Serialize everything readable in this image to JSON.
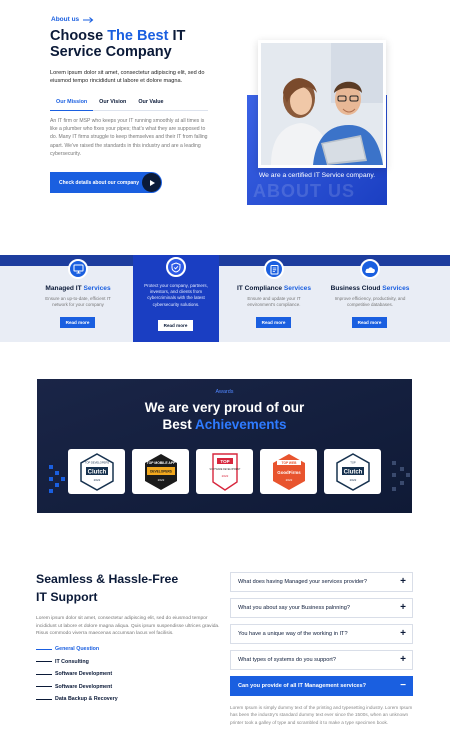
{
  "about": {
    "eyebrow": "About us",
    "title_part1": "Choose ",
    "title_highlight": "The Best",
    "title_part2": " IT Service Company",
    "lead": "Lorem ipsum dolor sit amet, consectetur adipiscing elit, sed do eiusmod tempo rincididunt ut labore et dolore magna.",
    "tabs": [
      {
        "label": "Our Mission",
        "active": true
      },
      {
        "label": "Our Vision",
        "active": false
      },
      {
        "label": "Our Value",
        "active": false
      }
    ],
    "tab_body": "An IT firm or MSP who keeps your IT running smoothly at all times is like a plumber who fixes your pipes; that's what they are supposed to do. Many IT firms struggle to keep themselves and their IT from falling apart. We've raised the standards in this industry and are a leading cybersecurity.",
    "cta_label": "Check details about our company",
    "photo_caption": "We are a certified IT Service company.",
    "photo_bg_text": "ABOUT US",
    "colors": {
      "accent": "#1a5fe0",
      "navy": "#0b1a38"
    }
  },
  "services": [
    {
      "title": "Managed IT ",
      "title_highlight": "Services",
      "desc": "Ensure an up-to-date, efficient IT network for your company",
      "button": "Read more",
      "icon": "monitor-icon",
      "featured": false
    },
    {
      "title": "",
      "title_highlight": "",
      "desc": "Protect your company, partners, investors, and clients from cybercriminals with the latest cybersecurity solutions.",
      "button": "Read more",
      "icon": "shield-icon",
      "featured": true
    },
    {
      "title": "IT Compliance ",
      "title_highlight": "Services",
      "desc": "Ensure and update your IT environment's compliance.",
      "button": "Read more",
      "icon": "clipboard-icon",
      "featured": false
    },
    {
      "title": "Business Cloud ",
      "title_highlight": "Services",
      "desc": "Improve efficiency, productivity, and competitive databases.",
      "button": "Read more",
      "icon": "cloud-icon",
      "featured": false
    }
  ],
  "awards": {
    "eyebrow": "Awards",
    "title_part1": "We are very proud of our",
    "title_part2": "Best ",
    "title_highlight": "Achievements",
    "badges": [
      {
        "name": "clutch-badge-1",
        "top": "TOP DEVELOPERS",
        "label": "Clutch",
        "year": "2022"
      },
      {
        "name": "top-mobile-app-badge",
        "top": "TOP MOBILE APP",
        "label": "DEVELOPERS",
        "year": "2022"
      },
      {
        "name": "top-software-badge",
        "top": "TOP",
        "label": "SOFTWARE DEVELOPMENT",
        "year": "2022"
      },
      {
        "name": "goodfirms-badge",
        "top": "TOP WEB",
        "label": "GoodFirms",
        "year": "2022"
      },
      {
        "name": "clutch-badge-2",
        "top": "TOP",
        "label": "Clutch",
        "year": "2022"
      }
    ]
  },
  "faq_section": {
    "title_line1": "Seamless & Hassle-Free",
    "title_line2": "IT Support",
    "lead": "Lorem ipsum dolor sit amet, consectetur adipiscing elit, sed do eiusmod tempor incididunt ut labore et dolore magna aliqua. Quis ipsum suspendisse ultrices gravida. Risus commodo viverra maecenas accumsan lacus vel facilisis.",
    "list": [
      {
        "label": "General Question",
        "active": true
      },
      {
        "label": "IT Consulting",
        "active": false
      },
      {
        "label": "Software Development",
        "active": false
      },
      {
        "label": "Software Development",
        "active": false
      },
      {
        "label": "Data Backup & Recovery",
        "active": false
      }
    ],
    "faqs": [
      {
        "q": "What does having Managed your services provider?",
        "sign": "+",
        "open": false
      },
      {
        "q": "What you about say your Business palnning?",
        "sign": "+",
        "open": false
      },
      {
        "q": "You have a unique way of the working in IT?",
        "sign": "+",
        "open": false
      },
      {
        "q": "What types of systems do you support?",
        "sign": "+",
        "open": false
      },
      {
        "q": "Can you provide of all IT Management services?",
        "sign": "−",
        "open": true
      }
    ],
    "answer": "Lorem Ipsum is simply dummy text of the printing and typesetting industry. Lorem Ipsum has been the industry's standard dummy text ever since the 1500s, when an unknown printer took a galley of type and scrambled it to make a type specimen book."
  }
}
